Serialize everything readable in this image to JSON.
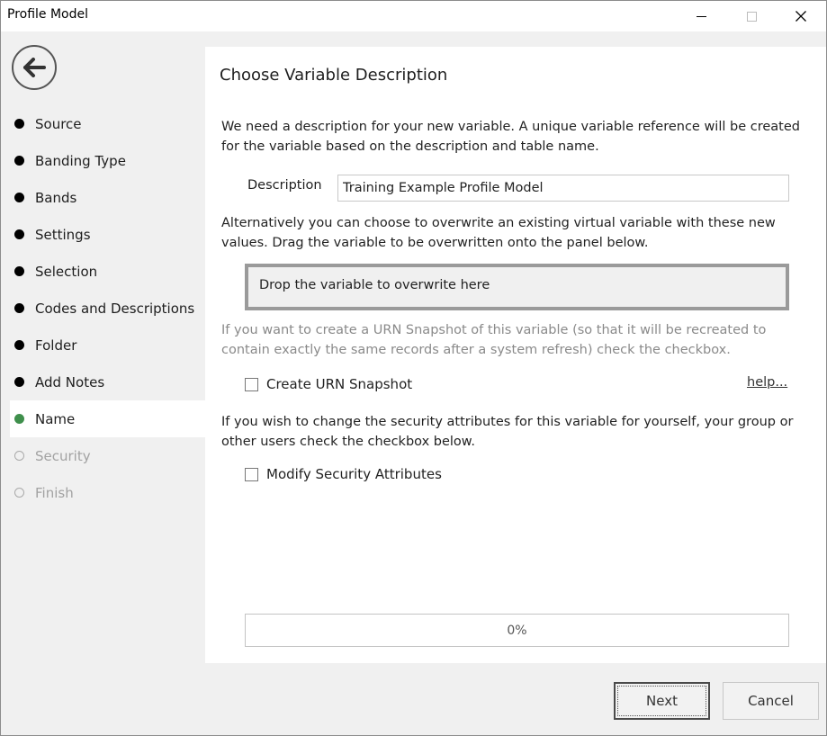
{
  "window": {
    "title": "Profile Model"
  },
  "nav": {
    "steps": [
      {
        "label": "Source",
        "state": "done"
      },
      {
        "label": "Banding Type",
        "state": "done"
      },
      {
        "label": "Bands",
        "state": "done"
      },
      {
        "label": "Settings",
        "state": "done"
      },
      {
        "label": "Selection",
        "state": "done"
      },
      {
        "label": "Codes and Descriptions",
        "state": "done"
      },
      {
        "label": "Folder",
        "state": "done"
      },
      {
        "label": "Add Notes",
        "state": "done"
      },
      {
        "label": "Name",
        "state": "current"
      },
      {
        "label": "Security",
        "state": "future"
      },
      {
        "label": "Finish",
        "state": "future"
      }
    ]
  },
  "main": {
    "heading": "Choose Variable Description",
    "intro": "We need a description for your new variable.  A unique variable reference will be created for the variable based on the description and table name.",
    "description_label": "Description",
    "description_value": "Training Example Profile Model",
    "overwrite_text": "Alternatively you can choose to overwrite an existing virtual variable with these new values. Drag the variable to be overwritten onto the panel below.",
    "drop_zone_text": "Drop the variable to overwrite here",
    "urn_text": "If you want to create a URN Snapshot of this variable (so that it will be recreated to contain exactly the same records after a system refresh) check the checkbox.",
    "urn_checkbox_label": "Create URN Snapshot",
    "urn_checked": false,
    "help_link": "help...",
    "security_text": "If you wish to change the security attributes for this variable for yourself, your group or other users check the checkbox below.",
    "security_checkbox_label": "Modify Security Attributes",
    "security_checked": false,
    "progress": {
      "label": "0%",
      "value": 0
    }
  },
  "footer": {
    "next_label": "Next",
    "cancel_label": "Cancel"
  },
  "colors": {
    "current_step": "#3f8f4c",
    "done_step": "#000000",
    "future_step": "#a9a9a9"
  }
}
